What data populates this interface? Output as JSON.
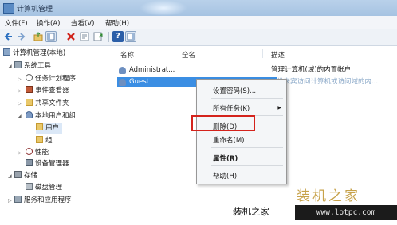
{
  "window": {
    "title": "计算机管理"
  },
  "menubar": {
    "items": [
      "文件(F)",
      "操作(A)",
      "查看(V)",
      "帮助(H)"
    ]
  },
  "toolbar": {
    "icons": [
      "back-icon",
      "forward-icon",
      "up-folder-icon",
      "show-tree-icon",
      "delete-icon",
      "properties-icon",
      "export-icon",
      "help-icon",
      "show-action-pane-icon"
    ]
  },
  "tree": {
    "root": "计算机管理(本地)",
    "system_tools": "系统工具",
    "task_scheduler": "任务计划程序",
    "event_viewer": "事件查看器",
    "shared_folders": "共享文件夹",
    "local_users_groups": "本地用户和组",
    "users": "用户",
    "groups": "组",
    "performance": "性能",
    "device_manager": "设备管理器",
    "storage": "存储",
    "disk_management": "磁盘管理",
    "services_apps": "服务和应用程序"
  },
  "columns": {
    "name": "名称",
    "full_name": "全名",
    "description": "描述"
  },
  "rows": [
    {
      "name": "Administrat...",
      "full_name": "",
      "description": "管理计算机(域)的内置帐户"
    },
    {
      "name": "Guest",
      "full_name": "",
      "description": "供来宾访问计算机或访问域的内..."
    }
  ],
  "context_menu": {
    "set_password": "设置密码(S)...",
    "all_tasks": "所有任务(K)",
    "delete": "删除(D)",
    "rename": "重命名(M)",
    "properties": "属性(R)",
    "help": "帮助(H)"
  },
  "watermark": {
    "brand": "装机之家",
    "caption": "装机之家",
    "url": "www.lotpc.com"
  },
  "colors": {
    "selection": "#3b8ee3",
    "highlight_box": "#d4231c",
    "titlebar": "#b9d1ea"
  }
}
